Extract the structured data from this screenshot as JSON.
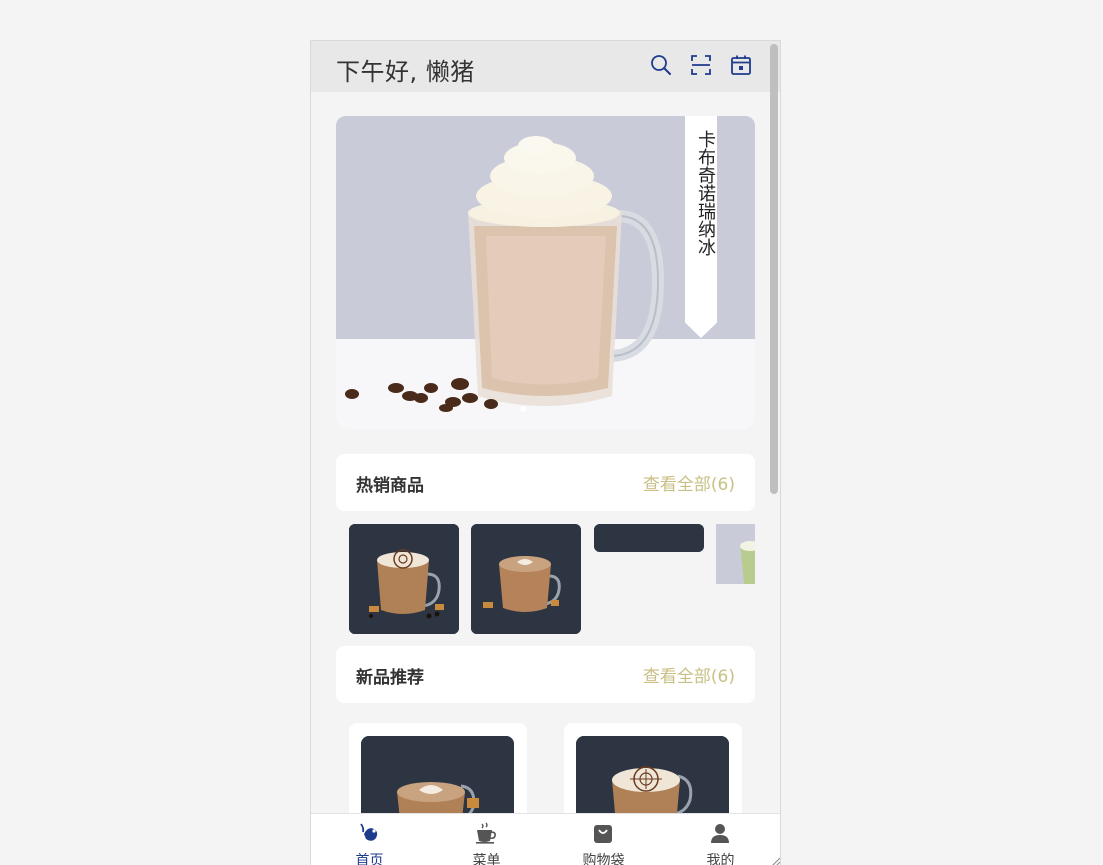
{
  "header": {
    "greeting": "下午好, 懒猪",
    "icons": [
      "search-icon",
      "scan-icon",
      "calendar-icon"
    ]
  },
  "banner": {
    "tag": "卡布奇诺瑞纳冰",
    "slide_index": 1,
    "slide_count": 1
  },
  "hot": {
    "title": "热销商品",
    "link": "查看全部(6)"
  },
  "new": {
    "title": "新品推荐",
    "link": "查看全部(6)"
  },
  "tabs": [
    {
      "label": "首页",
      "icon": "home-icon",
      "active": true
    },
    {
      "label": "菜单",
      "icon": "cup-icon",
      "active": false
    },
    {
      "label": "购物袋",
      "icon": "bag-icon",
      "active": false
    },
    {
      "label": "我的",
      "icon": "user-icon",
      "active": false
    }
  ],
  "colors": {
    "accent": "#1f3b8c",
    "link": "#c9bf84",
    "header_bg": "#e8e8e8",
    "banner_bg": "#cacbd9"
  }
}
